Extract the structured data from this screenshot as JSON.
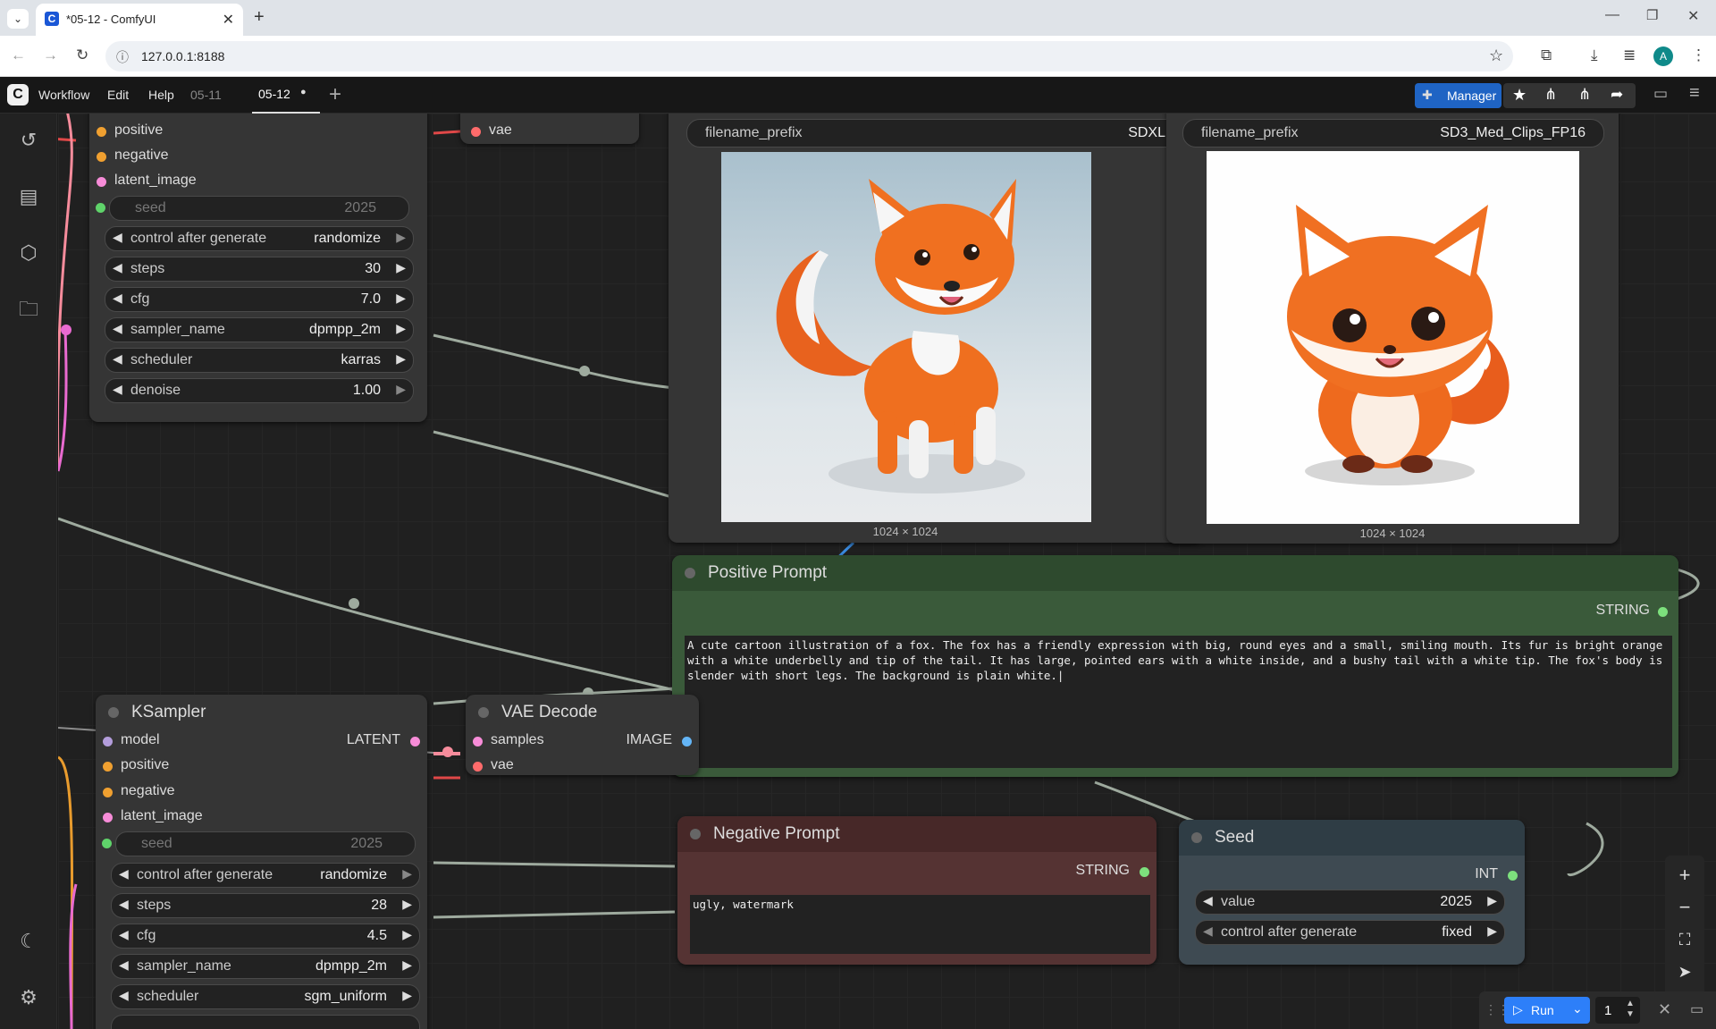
{
  "browser": {
    "tab_title": "*05-12 - ComfyUI",
    "url": "127.0.0.1:8188",
    "profile_initial": "A"
  },
  "topmenu": {
    "items": [
      "Workflow",
      "Edit",
      "Help"
    ],
    "workflow_tabs": [
      {
        "label": "05-11",
        "active": false
      },
      {
        "label": "05-12",
        "active": true,
        "modified_dot": "●"
      }
    ],
    "add_tab": "+",
    "manager_label": "Manager"
  },
  "nodes": {
    "ksampler_top": {
      "inputs": [
        "positive",
        "negative",
        "latent_image"
      ],
      "seed": {
        "label": "seed",
        "value": "2025"
      },
      "widgets": [
        {
          "label": "control after generate",
          "value": "randomize"
        },
        {
          "label": "steps",
          "value": "30"
        },
        {
          "label": "cfg",
          "value": "7.0"
        },
        {
          "label": "sampler_name",
          "value": "dpmpp_2m"
        },
        {
          "label": "scheduler",
          "value": "karras"
        },
        {
          "label": "denoise",
          "value": "1.00"
        }
      ]
    },
    "vae_top": {
      "input": "vae"
    },
    "save_sdxl": {
      "prefix_label": "filename_prefix",
      "prefix_value": "SDXL",
      "caption": "1024 × 1024"
    },
    "save_sd3": {
      "prefix_label": "filename_prefix",
      "prefix_value": "SD3_Med_Clips_FP16",
      "caption": "1024 × 1024"
    },
    "positive_prompt": {
      "title": "Positive Prompt",
      "output": "STRING",
      "text": "A cute cartoon illustration of a fox. The fox has a friendly expression with big, round eyes and a small, smiling mouth. Its fur is bright orange with a white underbelly and tip of the tail. It has large, pointed ears with a white inside, and a bushy tail with a white tip. The fox's body is slender with short legs. The background is plain white.|"
    },
    "ksampler_bottom": {
      "title": "KSampler",
      "inputs": [
        "model",
        "positive",
        "negative",
        "latent_image"
      ],
      "output": "LATENT",
      "seed": {
        "label": "seed",
        "value": "2025"
      },
      "widgets": [
        {
          "label": "control after generate",
          "value": "randomize"
        },
        {
          "label": "steps",
          "value": "28"
        },
        {
          "label": "cfg",
          "value": "4.5"
        },
        {
          "label": "sampler_name",
          "value": "dpmpp_2m"
        },
        {
          "label": "scheduler",
          "value": "sgm_uniform"
        }
      ]
    },
    "vae_decode": {
      "title": "VAE Decode",
      "inputs": [
        "samples",
        "vae"
      ],
      "output": "IMAGE"
    },
    "negative_prompt": {
      "title": "Negative Prompt",
      "output": "STRING",
      "text": "ugly, watermark"
    },
    "seed": {
      "title": "Seed",
      "output": "INT",
      "widgets": [
        {
          "label": "value",
          "value": "2025"
        },
        {
          "label": "control after generate",
          "value": "fixed"
        }
      ]
    }
  },
  "run_bar": {
    "run_label": "Run",
    "batch_count": "1"
  },
  "colors": {
    "positive_node": "#2e4a2e",
    "negative_node": "#4a2a2a",
    "seed_node": "#2e3c44",
    "accent_blue": "#2d7ff9"
  }
}
